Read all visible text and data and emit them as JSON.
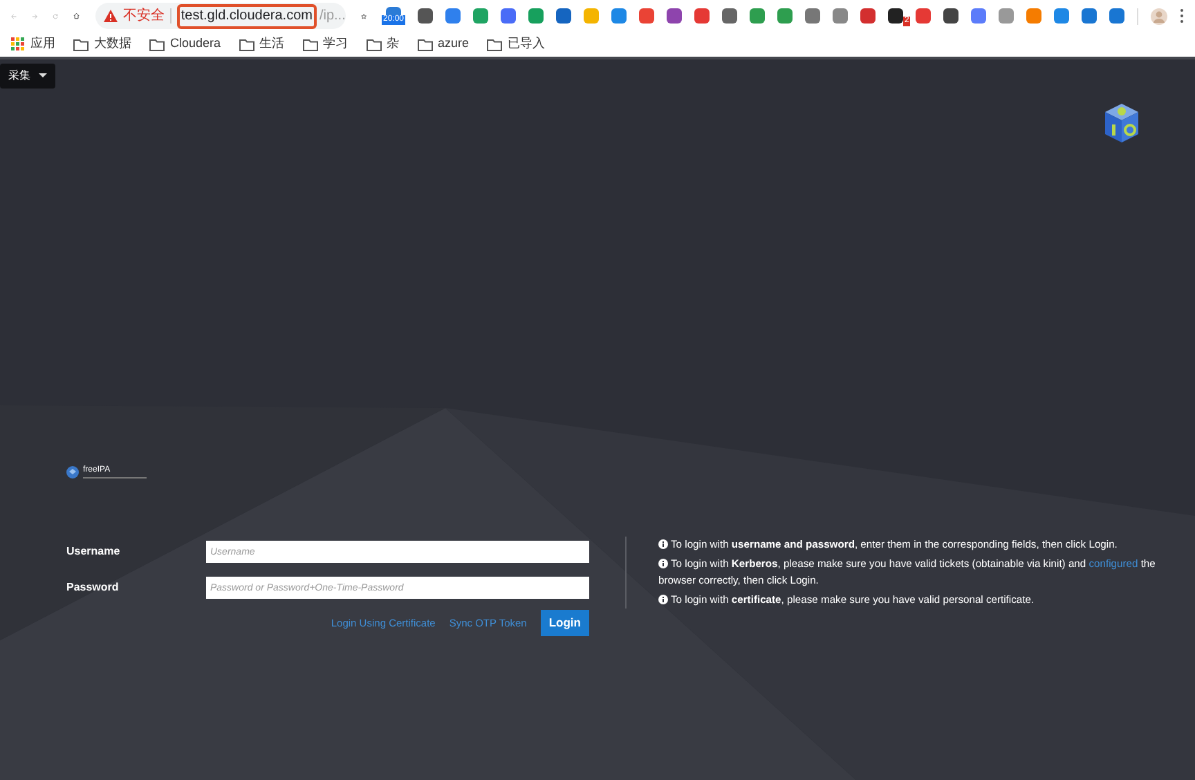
{
  "browser": {
    "security_label": "不安全",
    "url_host": "test.gld.cloudera.com",
    "url_rest": "/ip...",
    "extensions": [
      {
        "color": "#2b7bd6",
        "badge": "20:00"
      },
      {
        "color": "#555555"
      },
      {
        "color": "#2f80ed"
      },
      {
        "color": "#1fa463"
      },
      {
        "color": "#4a6cf7"
      },
      {
        "color": "#17a05d"
      },
      {
        "color": "#1565c0"
      },
      {
        "color": "#f4b400"
      },
      {
        "color": "#1e88e5"
      },
      {
        "color": "#ea4335"
      },
      {
        "color": "#8e44ad"
      },
      {
        "color": "#e53935"
      },
      {
        "color": "#666666"
      },
      {
        "color": "#2e9e4f"
      },
      {
        "color": "#2e9e4f"
      },
      {
        "color": "#777777"
      },
      {
        "color": "#888888"
      },
      {
        "color": "#d32f2f"
      },
      {
        "color": "#222222",
        "badge": "2"
      },
      {
        "color": "#e53935"
      },
      {
        "color": "#444444"
      },
      {
        "color": "#5c7cfa"
      },
      {
        "color": "#999999"
      },
      {
        "color": "#f57c00"
      },
      {
        "color": "#1e88e5"
      },
      {
        "color": "#1976d2"
      },
      {
        "color": "#1976d2"
      }
    ],
    "bookmarks": [
      {
        "label": "应用",
        "kind": "apps"
      },
      {
        "label": "大数据",
        "kind": "folder"
      },
      {
        "label": "Cloudera",
        "kind": "folder"
      },
      {
        "label": "生活",
        "kind": "folder"
      },
      {
        "label": "学习",
        "kind": "folder"
      },
      {
        "label": "杂",
        "kind": "folder"
      },
      {
        "label": "azure",
        "kind": "folder"
      },
      {
        "label": "已导入",
        "kind": "folder"
      }
    ]
  },
  "page": {
    "collect_button": "采集",
    "brand": "freeIPA",
    "form": {
      "fields": [
        {
          "label": "Username",
          "placeholder": "Username"
        },
        {
          "label": "Password",
          "placeholder": "Password or Password+One-Time-Password"
        }
      ],
      "links": [
        "Login Using Certificate",
        "Sync OTP Token"
      ],
      "login_button": "Login"
    },
    "info": [
      {
        "before": "To login with **username and password**, enter them in the corresponding fields, then click Login."
      },
      {
        "before": "To login with **Kerberos**, please make sure you have valid tickets (obtainable via kinit) and ",
        "link": "configured",
        "after": " the browser correctly, then click Login."
      },
      {
        "before": "To login with **certificate**, please make sure you have valid personal certificate."
      }
    ]
  }
}
